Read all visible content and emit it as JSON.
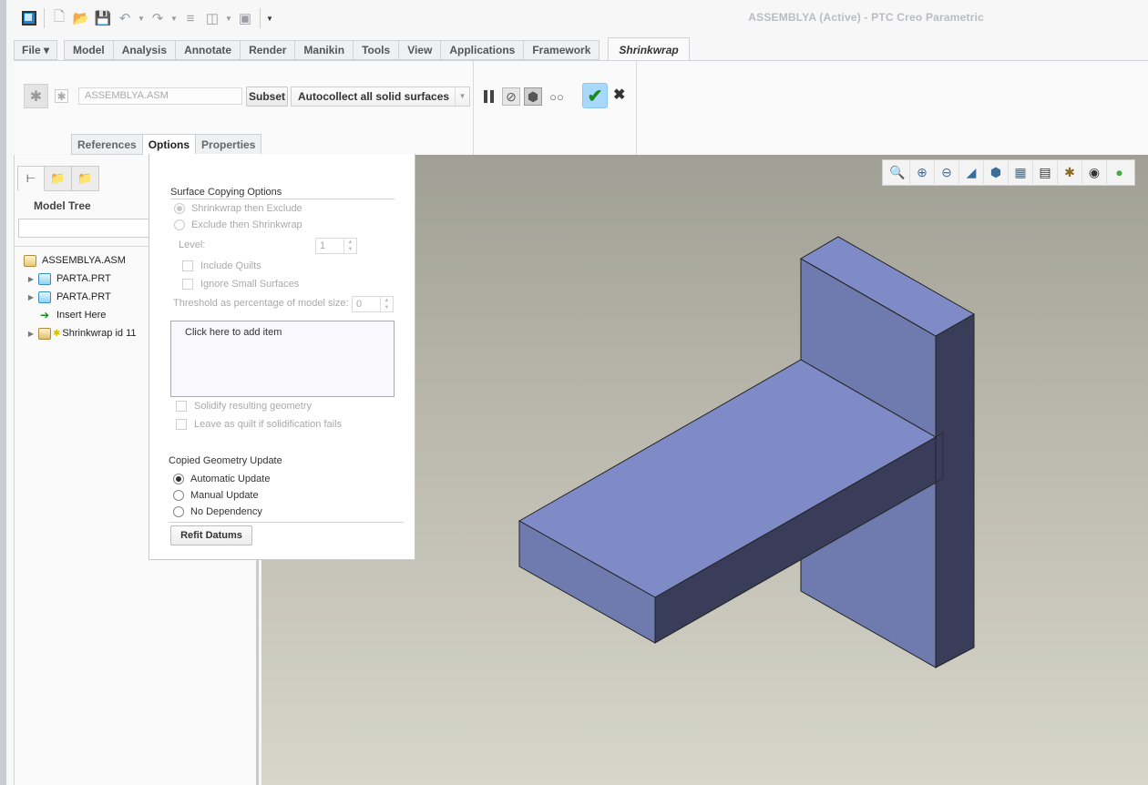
{
  "window": {
    "title": "ASSEMBLYA (Active) - PTC Creo Parametric"
  },
  "quick_access": {
    "icons": [
      "app-icon",
      "new-icon",
      "open-icon",
      "save-icon",
      "undo-icon",
      "redo-icon",
      "regenerate-icon",
      "windows-icon",
      "close-window-icon",
      "customize-icon"
    ]
  },
  "ribbon": {
    "tabs": [
      {
        "label": "File ▾",
        "active": false
      },
      {
        "label": "Model",
        "active": false
      },
      {
        "label": "Analysis",
        "active": false
      },
      {
        "label": "Annotate",
        "active": false
      },
      {
        "label": "Render",
        "active": false
      },
      {
        "label": "Manikin",
        "active": false
      },
      {
        "label": "Tools",
        "active": false
      },
      {
        "label": "View",
        "active": false
      },
      {
        "label": "Applications",
        "active": false
      },
      {
        "label": "Framework",
        "active": false
      },
      {
        "label": "Shrinkwrap",
        "active": true
      }
    ],
    "model_field_value": "ASSEMBLYA.ASM",
    "subset_label": "Subset",
    "collection_select": "Autocollect all solid surfaces",
    "subtabs": [
      {
        "label": "References",
        "active": false
      },
      {
        "label": "Options",
        "active": true
      },
      {
        "label": "Properties",
        "active": false
      }
    ]
  },
  "model_tree": {
    "title": "Model Tree",
    "search_value": "",
    "items": [
      {
        "label": "ASSEMBLYA.ASM",
        "icon": "assembly-icon",
        "expandable": false
      },
      {
        "label": "PARTA.PRT",
        "icon": "part-icon",
        "expandable": true
      },
      {
        "label": "PARTA.PRT",
        "icon": "part-icon",
        "expandable": true
      },
      {
        "label": "Insert Here",
        "icon": "insert-arrow-icon",
        "expandable": false
      },
      {
        "label": "Shrinkwrap id 11",
        "icon": "shrinkwrap-feature-icon",
        "expandable": true
      }
    ]
  },
  "options": {
    "surface_copying_title": "Surface Copying Options",
    "method_options": [
      {
        "label": "Shrinkwrap then Exclude",
        "selected": true,
        "enabled": false
      },
      {
        "label": "Exclude then Shrinkwrap",
        "selected": false,
        "enabled": false
      }
    ],
    "level_label": "Level:",
    "level_value": "1",
    "include_quilts": {
      "label": "Include Quilts",
      "checked": false,
      "enabled": false
    },
    "ignore_small": {
      "label": "Ignore Small Surfaces",
      "checked": false,
      "enabled": false
    },
    "threshold_label": "Threshold as percentage of model size:",
    "threshold_value": "0",
    "collector_placeholder": "Click here to add item",
    "solidify": {
      "label": "Solidify resulting geometry",
      "checked": false,
      "enabled": false
    },
    "leave_quilt": {
      "label": "Leave as quilt if solidification fails",
      "checked": false,
      "enabled": false
    },
    "update_title": "Copied Geometry Update",
    "update_options": [
      {
        "label": "Automatic Update",
        "selected": true
      },
      {
        "label": "Manual Update",
        "selected": false
      },
      {
        "label": "No Dependency",
        "selected": false
      }
    ],
    "refit_label": "Refit Datums"
  },
  "graphics_toolbar": {
    "icons": [
      "refit-icon",
      "zoom-in-icon",
      "zoom-out-icon",
      "repaint-icon",
      "display-style-icon",
      "saved-orientations-icon",
      "view-manager-icon",
      "datum-display-icon",
      "annotation-display-icon",
      "spin-center-icon"
    ]
  },
  "colors": {
    "model_top": "#7f8bc6",
    "model_front": "#6f7baf",
    "model_side": "#393d5a",
    "ok_button": "#a8d8fb"
  }
}
